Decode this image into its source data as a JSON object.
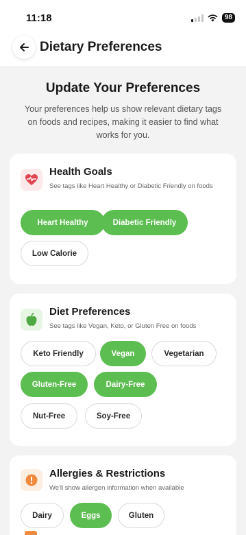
{
  "status": {
    "time": "11:18",
    "battery": "98"
  },
  "nav": {
    "title": "Dietary Preferences"
  },
  "intro": {
    "heading": "Update Your Preferences",
    "body": "Your preferences help us show relevant dietary tags on foods and recipes, making it easier to find what works for you."
  },
  "cards": {
    "health": {
      "icon": "heart-pulse-icon",
      "title": "Health Goals",
      "desc": "See tags like Heart Healthy or Diabetic Friendly on foods",
      "chips": [
        {
          "label": "Heart Healthy",
          "selected": true
        },
        {
          "label": "Diabetic Friendly",
          "selected": true
        },
        {
          "label": "Low Calorie",
          "selected": false
        }
      ]
    },
    "diet": {
      "icon": "apple-icon",
      "title": "Diet Preferences",
      "desc": "See tags like Vegan, Keto, or Gluten Free on foods",
      "chips": [
        {
          "label": "Keto Friendly",
          "selected": false
        },
        {
          "label": "Vegan",
          "selected": true
        },
        {
          "label": "Vegetarian",
          "selected": false
        },
        {
          "label": "Gluten-Free",
          "selected": true
        },
        {
          "label": "Dairy-Free",
          "selected": true
        },
        {
          "label": "Nut-Free",
          "selected": false
        },
        {
          "label": "Soy-Free",
          "selected": false
        }
      ]
    },
    "allergies": {
      "icon": "alert-icon",
      "title": "Allergies & Restrictions",
      "desc": "We'll show allergen information when available",
      "chips": [
        {
          "label": "Dairy",
          "selected": false
        },
        {
          "label": "Eggs",
          "selected": true
        },
        {
          "label": "Gluten",
          "selected": false
        }
      ]
    }
  },
  "colors": {
    "accent": "#5cbd50",
    "alert": "#f08a3c",
    "heart": "#e0454f",
    "background": "#f3f3f3"
  }
}
